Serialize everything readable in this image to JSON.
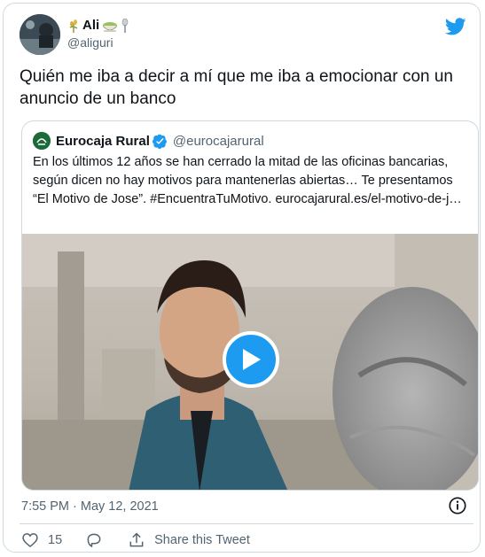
{
  "author": {
    "display_name": "Ali",
    "handle": "@aliguri"
  },
  "tweet": {
    "text": "Quién me iba a decir a mí que me iba a emocionar con un anuncio de un banco"
  },
  "quoted": {
    "display_name": "Eurocaja Rural",
    "handle": "@eurocajarural",
    "text": "En los últimos 12 años se han cerrado la mitad de las oficinas bancarias, según dicen no hay motivos para mantenerlas abiertas… Te presentamos “El Motivo de Jose”. #EncuentraTuMotivo. eurocajarural.es/el-motivo-de-j…"
  },
  "meta": {
    "timestamp": "7:55 PM · May 12, 2021"
  },
  "actions": {
    "like_count": "15",
    "share_label": "Share this Tweet"
  },
  "colors": {
    "accent": "#1d9bf0",
    "text": "#0f1419",
    "secondary": "#536471",
    "border": "#cfd9de"
  },
  "icons": [
    "twitter-bird-icon",
    "verified-badge-icon",
    "play-icon",
    "info-icon",
    "heart-icon",
    "reply-icon",
    "share-icon"
  ]
}
